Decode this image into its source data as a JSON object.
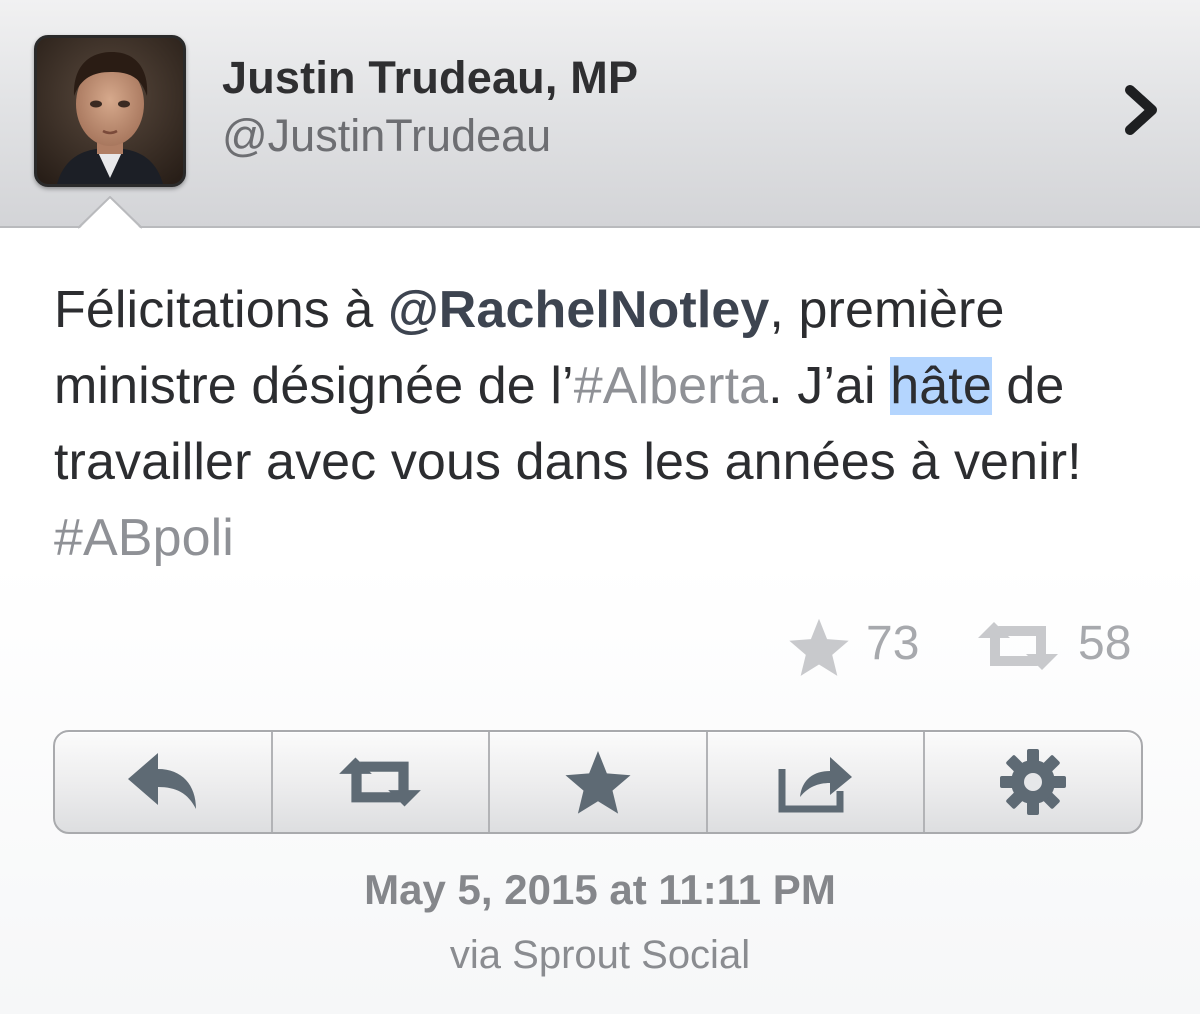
{
  "profile": {
    "display_name": "Justin Trudeau, MP",
    "handle": "@JustinTrudeau",
    "avatar_icon": "profile-photo"
  },
  "tweet": {
    "segments": [
      {
        "text": "Félicitations à ",
        "type": "text"
      },
      {
        "text": "@RachelNotley",
        "type": "mention"
      },
      {
        "text": ", première ministre désignée de l’",
        "type": "text"
      },
      {
        "text": "#Alberta",
        "type": "hashtag"
      },
      {
        "text": ". J’ai ",
        "type": "text"
      },
      {
        "text": "hâte",
        "type": "highlight"
      },
      {
        "text": " de travailler avec vous dans les années à venir! ",
        "type": "text"
      },
      {
        "text": "#ABpoli",
        "type": "hashtag"
      }
    ]
  },
  "stats": {
    "favorites": "73",
    "retweets": "58",
    "favorite_icon": "star-icon",
    "retweet_icon": "retweet-icon"
  },
  "actions": [
    {
      "name": "reply",
      "icon": "reply-icon"
    },
    {
      "name": "retweet",
      "icon": "retweet-icon"
    },
    {
      "name": "favorite",
      "icon": "star-icon"
    },
    {
      "name": "share",
      "icon": "share-icon"
    },
    {
      "name": "settings",
      "icon": "gear-icon"
    }
  ],
  "footer": {
    "timestamp": "May 5, 2015 at 11:11 PM",
    "source": "via Sprout Social"
  },
  "colors": {
    "highlight": "#b4d5fe",
    "hashtag": "#8f9196",
    "text": "#2c2d30",
    "icon": "#5e6a74"
  }
}
